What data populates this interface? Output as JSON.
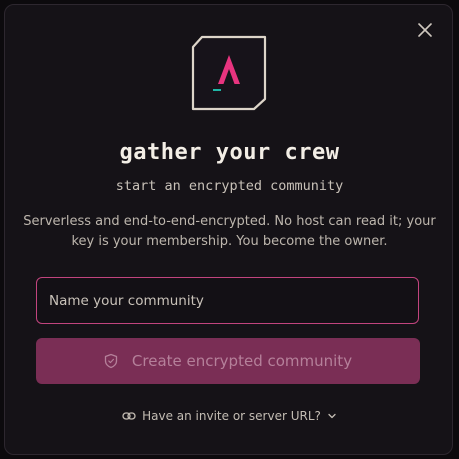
{
  "dialog": {
    "title": "gather your crew",
    "subtitle": "start an encrypted community",
    "description": "Serverless and end-to-end-encrypted. No host can read it; your key is your membership. You become the owner.",
    "close_icon": "close-icon",
    "logo_icon": "app-logo-a"
  },
  "form": {
    "name_placeholder": "Name your community",
    "name_value": "",
    "create_label": "Create encrypted community",
    "create_icon": "shield-icon",
    "create_disabled": true
  },
  "invite": {
    "label": "Have an invite or server URL?",
    "icon": "link-icon",
    "chevron": "chevron-down-icon"
  },
  "colors": {
    "accent": "#e8347f",
    "accent_muted": "#7a2e55",
    "input_border": "#c2447e",
    "teal": "#1fb6a6",
    "background": "#151217"
  }
}
